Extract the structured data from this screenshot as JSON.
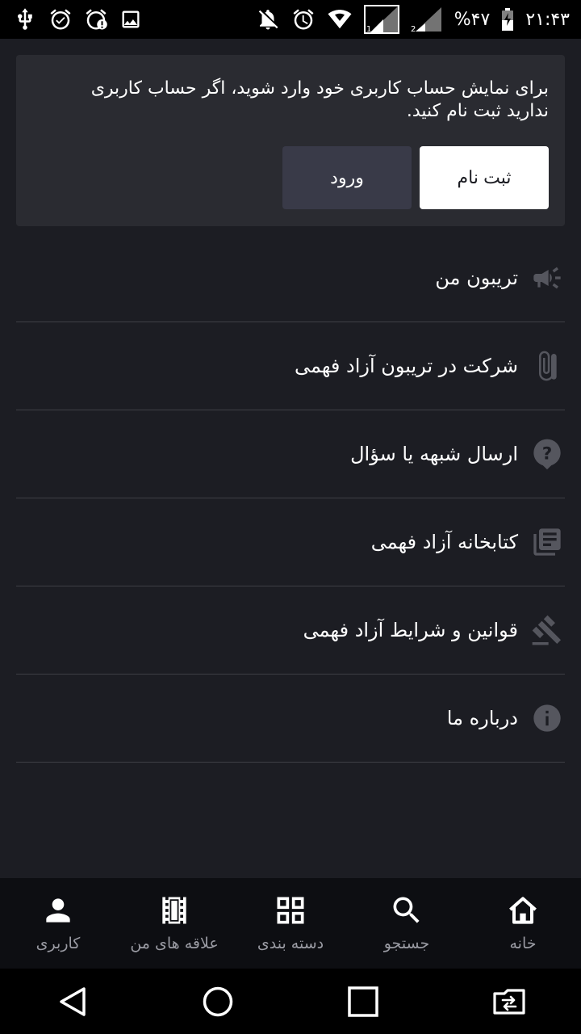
{
  "status_bar": {
    "battery_percent": "%۴۷",
    "time": "۲۱:۴۳",
    "left_icons": [
      "usb-icon",
      "alarm-check-icon",
      "alarm-alert-icon",
      "image-icon"
    ],
    "right_icons": [
      "mute-icon",
      "alarm-icon",
      "wifi-icon",
      "signal-sim1-icon",
      "signal-sim2-icon",
      "battery-icon"
    ]
  },
  "login_card": {
    "message": "برای نمایش حساب کاربری خود وارد شوید، اگر حساب کاربری ندارید ثبت نام کنید.",
    "register_label": "ثبت نام",
    "login_label": "ورود"
  },
  "menu": {
    "items": [
      {
        "label": "تریبون من",
        "icon": "megaphone-icon"
      },
      {
        "label": "شرکت در تریبون آزاد فهمی",
        "icon": "attachment-icon"
      },
      {
        "label": "ارسال شبهه یا سؤال",
        "icon": "question-icon"
      },
      {
        "label": "کتابخانه آزاد فهمی",
        "icon": "library-icon"
      },
      {
        "label": "قوانین و شرایط آزاد فهمی",
        "icon": "gavel-icon"
      },
      {
        "label": "درباره ما",
        "icon": "info-icon"
      }
    ]
  },
  "bottom_nav": {
    "items": [
      {
        "label": "خانه",
        "icon": "home-icon"
      },
      {
        "label": "جستجو",
        "icon": "search-icon"
      },
      {
        "label": "دسته بندی",
        "icon": "grid-icon"
      },
      {
        "label": "علاقه های من",
        "icon": "film-icon"
      },
      {
        "label": "کاربری",
        "icon": "person-icon"
      }
    ]
  },
  "colors": {
    "background": "#1c1d23",
    "card": "#2a2b31",
    "login_button": "#393a48",
    "icon_gray": "#55565e",
    "nav_label": "#9a9ba3"
  }
}
